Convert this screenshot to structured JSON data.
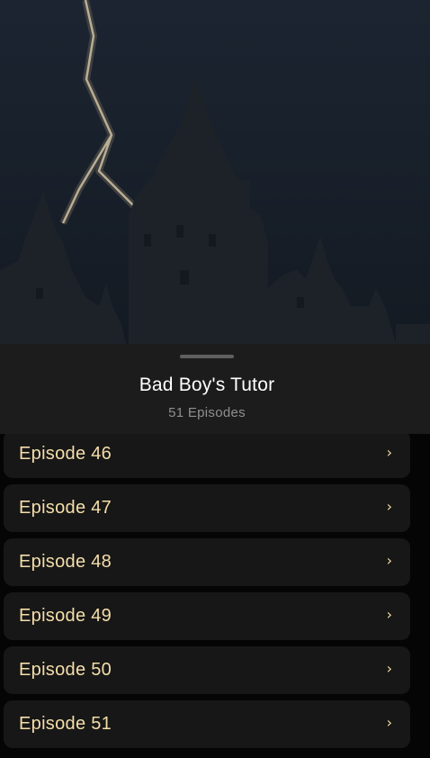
{
  "series": {
    "title": "Bad Boy's Tutor",
    "episodes_count": "51 Episodes"
  },
  "hero": {
    "image": "dark-castle-with-lightning-cover"
  },
  "episodes": [
    {
      "label": "Episode 46",
      "icon": "chevron-right-icon"
    },
    {
      "label": "Episode 47",
      "icon": "chevron-right-icon"
    },
    {
      "label": "Episode 48",
      "icon": "chevron-right-icon"
    },
    {
      "label": "Episode 49",
      "icon": "chevron-right-icon"
    },
    {
      "label": "Episode 50",
      "icon": "chevron-right-icon"
    },
    {
      "label": "Episode 51",
      "icon": "chevron-right-icon"
    }
  ],
  "colors": {
    "accent": "#f5deaa",
    "sheet": "#1c1c1c",
    "row": "#171717",
    "background": "#050505"
  }
}
